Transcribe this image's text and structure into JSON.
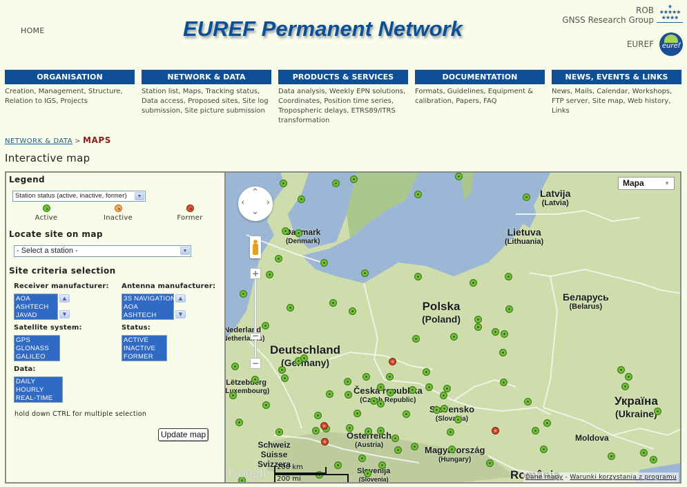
{
  "header": {
    "home_label": "HOME",
    "site_title": "EUREF Permanent Network",
    "rob_label": "ROB",
    "rob_group": "GNSS Research Group",
    "euref_label": "EUREF",
    "euref_logo_text": "euref",
    "rob_stars_icon": "★\n★★★★★\n★★★★"
  },
  "nav": [
    {
      "label": "ORGANISATION",
      "desc": "Creation, Management, Structure, Relation to IGS, Projects"
    },
    {
      "label": "NETWORK & DATA",
      "desc": "Station list, Maps, Tracking status, Data access, Proposed sites, Site log submission, Site picture submission"
    },
    {
      "label": "PRODUCTS & SERVICES",
      "desc": "Data analysis, Weekly EPN solutions, Coordinates, Position time series, Tropospheric delays, ETRS89/ITRS transformation"
    },
    {
      "label": "DOCUMENTATION",
      "desc": "Formats, Guidelines, Equipment & calibration, Papers, FAQ"
    },
    {
      "label": "NEWS, EVENTS & LINKS",
      "desc": "News, Mails, Calendar, Workshops, FTP server, Site map, Web history, Links"
    }
  ],
  "breadcrumb": {
    "parent": "NETWORK & DATA",
    "separator": ">",
    "current": "MAPS"
  },
  "page_title": "Interactive map",
  "panel": {
    "legend_heading": "Legend",
    "legend_select": "Station status (active, inactive, former)",
    "legend_items": [
      {
        "label": "Active",
        "color": "#6cc13a"
      },
      {
        "label": "Inactive",
        "color": "#f0a860"
      },
      {
        "label": "Former",
        "color": "#d4553a"
      }
    ],
    "locate_heading": "Locate site on map",
    "station_select": "- Select a station -",
    "criteria_heading": "Site criteria selection",
    "receiver_label": "Receiver manufacturer:",
    "receiver_options": [
      "AOA",
      "ASHTECH",
      "JAVAD"
    ],
    "antenna_label": "Antenna manufacturer:",
    "antenna_options": [
      "3S NAVIGATION",
      "AOA",
      "ASHTECH"
    ],
    "satellite_label": "Satellite system:",
    "satellite_options": [
      "GPS",
      "GLONASS",
      "GALILEO"
    ],
    "status_label": "Status:",
    "status_options": [
      "ACTIVE",
      "INACTIVE",
      "FORMER"
    ],
    "data_label": "Data:",
    "data_options": [
      "DAILY",
      "HOURLY",
      "REAL-TIME"
    ],
    "hint": "hold down CTRL for multiple selection",
    "update_button": "Update map"
  },
  "map": {
    "map_type": "Mapa",
    "google_logo": "Google",
    "scale_km": "200 km",
    "scale_mi": "200 mi",
    "attribution_data": "Dane mapy",
    "attribution_sep": "-",
    "attribution_terms": "Warunki korzystania z programu",
    "labels": [
      {
        "name": "Latvija",
        "sub": "(Latvia)"
      },
      {
        "name": "Danmark",
        "sub": "(Denmark)"
      },
      {
        "name": "Lietuva",
        "sub": "(Lithuania)"
      },
      {
        "name": "Polska",
        "sub": "(Poland)"
      },
      {
        "name": "Беларусь",
        "sub": "(Belarus)"
      },
      {
        "name": "Deutschland",
        "sub": "(Germany)"
      },
      {
        "name": "Česká republika",
        "sub": "(Czech Republic)"
      },
      {
        "name": "Slovensko",
        "sub": "(Slovakia)"
      },
      {
        "name": "Україна",
        "sub": "(Ukraine)"
      },
      {
        "name": "Österreich",
        "sub": "(Austria)"
      },
      {
        "name": "Magyarország",
        "sub": "(Hungary)"
      },
      {
        "name": "Moldova",
        "sub": ""
      },
      {
        "name": "Schweiz",
        "sub": "Suisse Svizzera"
      },
      {
        "name": "Slovenija",
        "sub": "(Slovenia)"
      },
      {
        "name": "România",
        "sub": ""
      },
      {
        "name": "Nederland",
        "sub": "(Netherlands)"
      },
      {
        "name": "Lëtzebuerg",
        "sub": "(Luxembourg)"
      }
    ]
  }
}
